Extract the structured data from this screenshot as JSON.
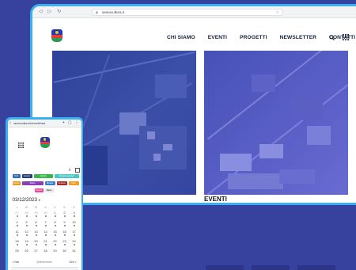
{
  "colors": {
    "background": "#37419e",
    "frame": "#3ab0ef",
    "nav_text": "#16213a"
  },
  "desktop": {
    "url": "ianeucultura.it",
    "nav": [
      "CHI SIAMO",
      "EVENTI",
      "PROGETTI",
      "NEWSLETTER",
      "CONTATTI"
    ],
    "icons": [
      "search-icon",
      "grid-menu-icon"
    ],
    "section_title": "EVENTI"
  },
  "mobile": {
    "url": "ianeucultura.it/eventi/mes",
    "icons": [
      "menu-grid-icon",
      "search-icon",
      "filter-icon"
    ],
    "tags": [
      {
        "label": "Tutti",
        "color": "#2d6fb7"
      },
      {
        "label": "Eventi",
        "color": "#23407d"
      },
      {
        "label": "Attività",
        "color": "#3bb54a"
      },
      {
        "label": "Progetti speciali",
        "color": "#4ac6c8"
      },
      {
        "label": "Mostre",
        "color": "#e79a1e"
      },
      {
        "label": "Teatro",
        "color": "#8a3fb8"
      },
      {
        "label": "Musica",
        "color": "#3a7fca"
      },
      {
        "label": "Cinema",
        "color": "#9e2d2d"
      },
      {
        "label": "Libri",
        "color": "#f29b2a"
      },
      {
        "label": "Incontri",
        "color": "#e8499b"
      }
    ],
    "active_view": "Mese",
    "date": "03/12/2023",
    "weekdays": [
      "L",
      "M",
      "M",
      "G",
      "V",
      "S",
      "D"
    ],
    "weeks": [
      [
        "27",
        "28",
        "29",
        "30",
        "1",
        "2",
        "3"
      ],
      [
        "4",
        "5",
        "6",
        "7",
        "8",
        "9",
        "10"
      ],
      [
        "11",
        "12",
        "13",
        "14",
        "15",
        "16",
        "17"
      ],
      [
        "18",
        "19",
        "20",
        "21",
        "22",
        "23",
        "24"
      ],
      [
        "25",
        "26",
        "27",
        "28",
        "29",
        "30",
        "31"
      ]
    ],
    "prev": "< Nov",
    "month_label": "Questo mese",
    "next": "Gen >"
  }
}
